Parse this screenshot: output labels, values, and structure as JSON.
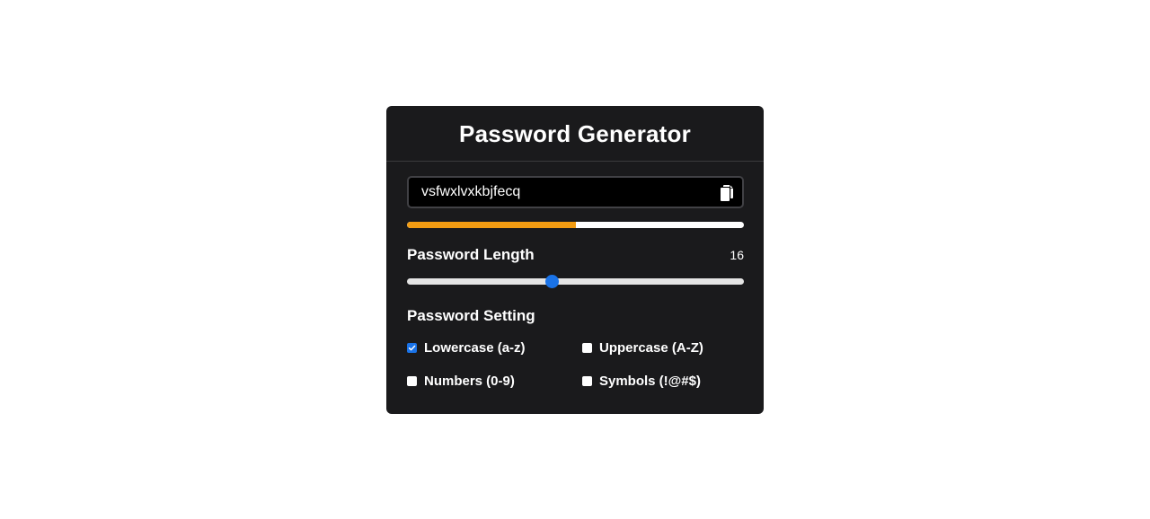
{
  "header": {
    "title": "Password Generator"
  },
  "password": {
    "value": "vsfwxlvxkbjfecq",
    "copy_icon": "copy-icon"
  },
  "strength": {
    "fill_fraction": 0.5,
    "color": "#f39c12"
  },
  "length": {
    "label": "Password Length",
    "value": "16",
    "slider_min": 1,
    "slider_max": 36,
    "slider_value": 16,
    "thumb_color": "#1a73e8"
  },
  "settings": {
    "label": "Password Setting",
    "options": [
      {
        "label": "Lowercase (a-z)",
        "checked": true
      },
      {
        "label": "Uppercase (A-Z)",
        "checked": false
      },
      {
        "label": "Numbers (0-9)",
        "checked": false
      },
      {
        "label": "Symbols (!@#$)",
        "checked": false
      }
    ]
  }
}
